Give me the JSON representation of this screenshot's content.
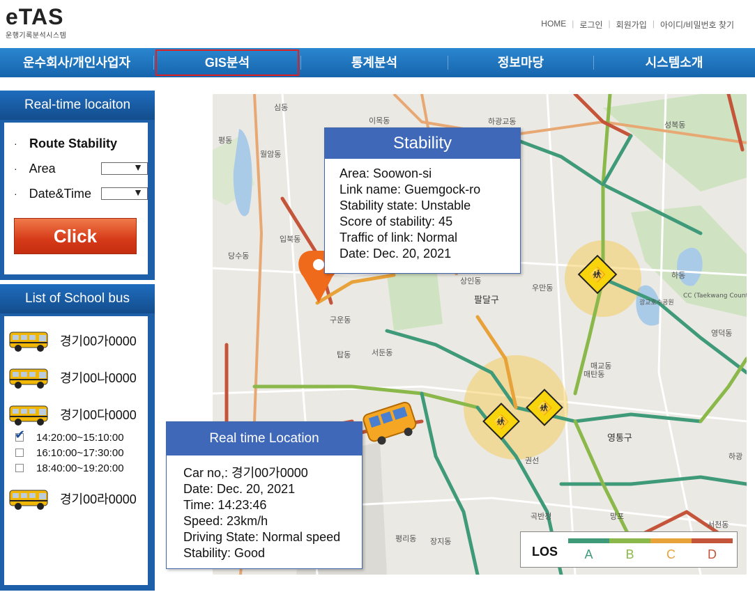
{
  "header": {
    "logo": "eTAS",
    "logo_sub": "운행기록분석시스템",
    "links": [
      "HOME",
      "로그인",
      "회원가입",
      "아이디/비밀번호 찾기"
    ]
  },
  "nav": {
    "items": [
      "운수회사/개인사업자",
      "GIS분석",
      "통계분석",
      "정보마당",
      "시스템소개"
    ],
    "active": "GIS분석"
  },
  "realtime_panel": {
    "title": "Real-time locaiton",
    "rows": [
      "Route Stability",
      "Area",
      "Date&Time"
    ],
    "area_value": "",
    "datetime_value": "",
    "button": "Click"
  },
  "bus_panel": {
    "title": "List of School bus",
    "buses": [
      "경기00가0000",
      "경기00나0000",
      "경기00다0000",
      "경기00라0000"
    ],
    "times": [
      {
        "label": "14:20:00~15:10:00",
        "checked": true
      },
      {
        "label": "16:10:00~17:30:00",
        "checked": false
      },
      {
        "label": "18:40:00~19:20:00",
        "checked": false
      }
    ]
  },
  "stability_popup": {
    "title": "Stability",
    "lines": [
      "Area: Soowon-si",
      "Link name: Guemgock-ro",
      "Stability state: Unstable",
      "Score of stability: 45",
      "Traffic of link: Normal",
      "Date: Dec. 20, 2021"
    ]
  },
  "location_popup": {
    "title": "Real time Location",
    "lines": [
      "Car no,: 경기00가0000",
      "Date: Dec. 20, 2021",
      "Time: 14:23:46",
      "Speed: 23km/h",
      "Driving State: Normal speed",
      "Stability: Good"
    ]
  },
  "legend": {
    "title": "LOS",
    "levels": [
      {
        "label": "A",
        "color": "#3f9a7a"
      },
      {
        "label": "B",
        "color": "#8bb84a"
      },
      {
        "label": "C",
        "color": "#e8a23a"
      },
      {
        "label": "D",
        "color": "#c4543a"
      }
    ]
  },
  "map_labels": [
    "심동",
    "이목동",
    "하광교동",
    "성복동",
    "평동",
    "월암동",
    "입북동",
    "당수동",
    "상인동",
    "팔달구",
    "우만동",
    "구운동",
    "탑동",
    "서둔동",
    "매교동",
    "매탄동",
    "영통구",
    "권선",
    "곡반정",
    "평리동",
    "장지동",
    "하동",
    "영덕동",
    "광교호수공원",
    "CC (Taekwang Country Club)",
    "하광",
    "서천동",
    "망포"
  ]
}
